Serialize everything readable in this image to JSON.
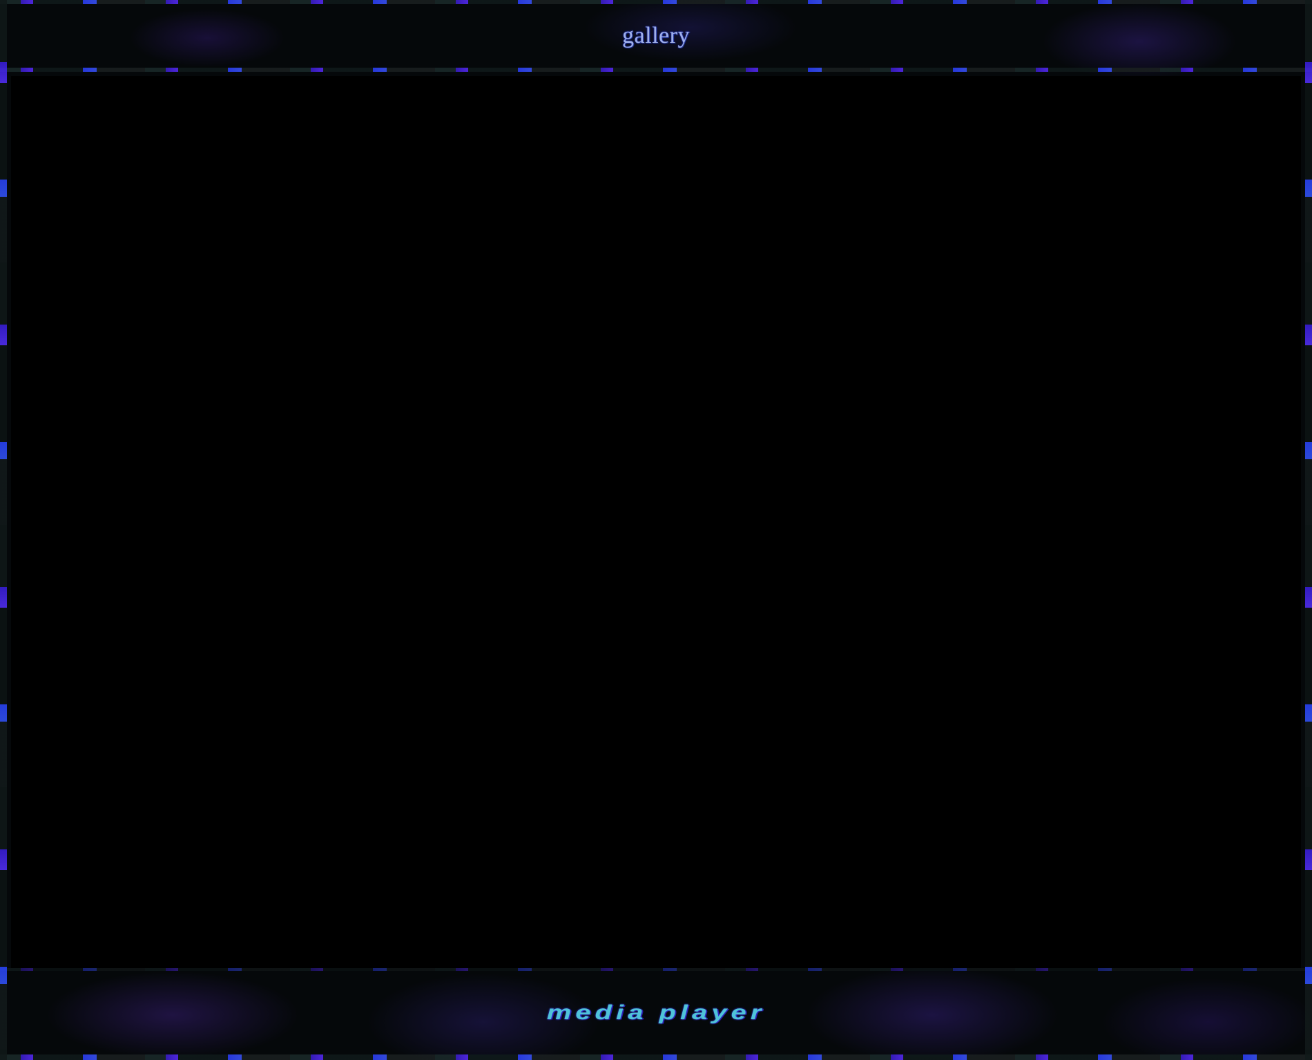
{
  "header": {
    "title": "gallery"
  },
  "footer": {
    "link_label": "media player"
  },
  "colors": {
    "background": "#000000",
    "frame": "#05080a",
    "accent_purple": "#5530ff",
    "accent_blue": "#2a45ff",
    "title_text": "#9fb0e8",
    "footer_text": "#4fc3d9"
  }
}
